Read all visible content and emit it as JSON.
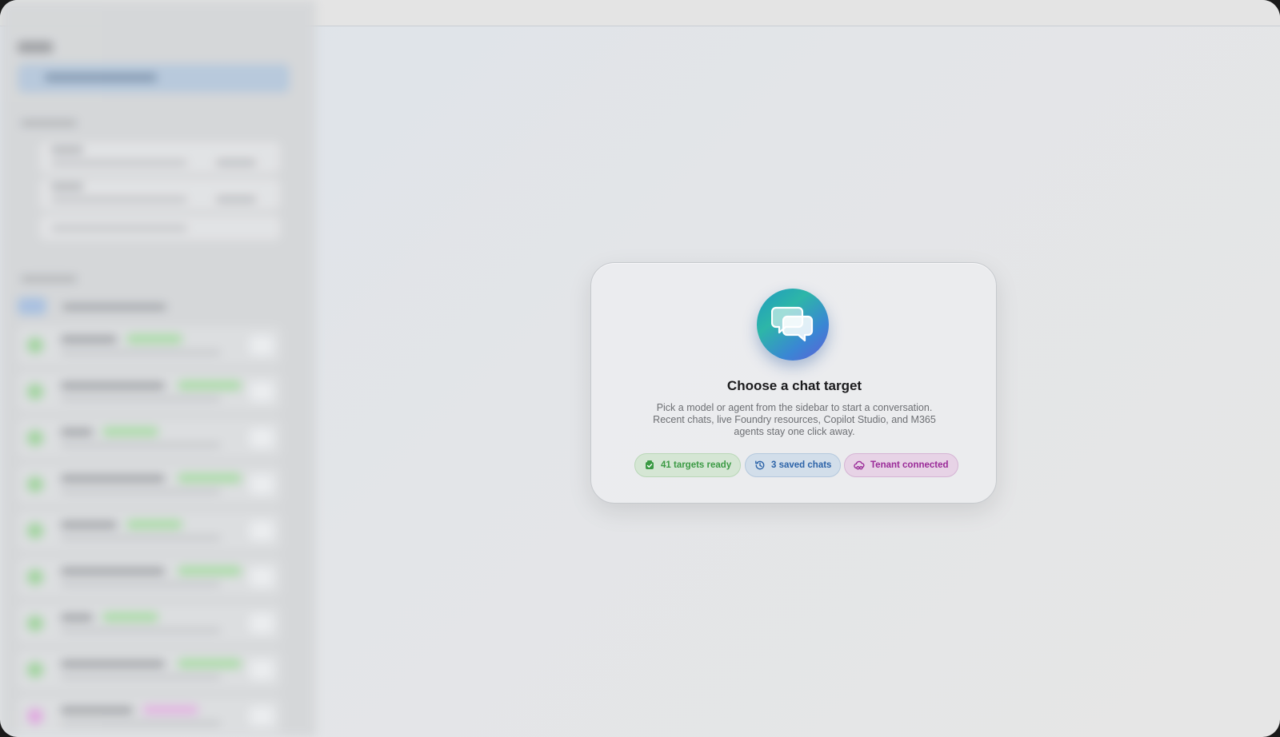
{
  "main": {
    "empty_state": {
      "icon": "chat-bubbles-icon",
      "title": "Choose a chat target",
      "description": "Pick a model or agent from the sidebar to start a conversation. Recent chats, live Foundry resources, Copilot Studio, and M365 agents stay one click away.",
      "badges": [
        {
          "label": "41 targets ready",
          "icon": "package-check-icon",
          "color": "#3b9a44"
        },
        {
          "label": "3 saved chats",
          "icon": "history-icon",
          "color": "#2c63a8"
        },
        {
          "label": "Tenant connected",
          "icon": "cloud-link-icon",
          "color": "#9a2a98"
        }
      ]
    }
  },
  "colors": {
    "accent_gradient_start": "#1f9ac0",
    "accent_gradient_end": "#5f5fd6"
  }
}
